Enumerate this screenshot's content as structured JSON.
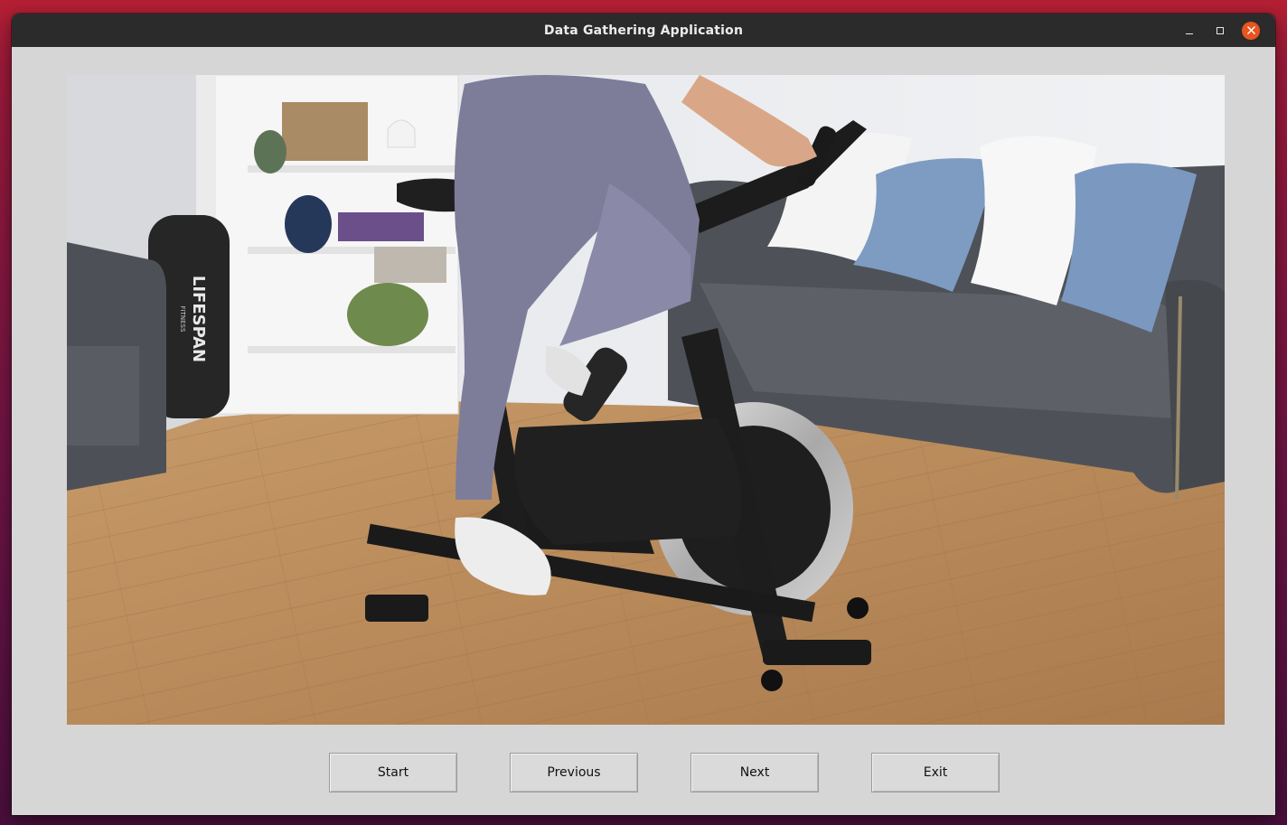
{
  "window": {
    "title": "Data Gathering Application",
    "controls": {
      "minimize_icon": "minimize-icon",
      "maximize_icon": "maximize-icon",
      "close_icon": "close-icon",
      "close_color": "#e95420"
    }
  },
  "image": {
    "logo_text": "LIFESPAN",
    "logo_subtext": "FITNESS"
  },
  "buttons": {
    "start": "Start",
    "previous": "Previous",
    "next": "Next",
    "exit": "Exit"
  }
}
